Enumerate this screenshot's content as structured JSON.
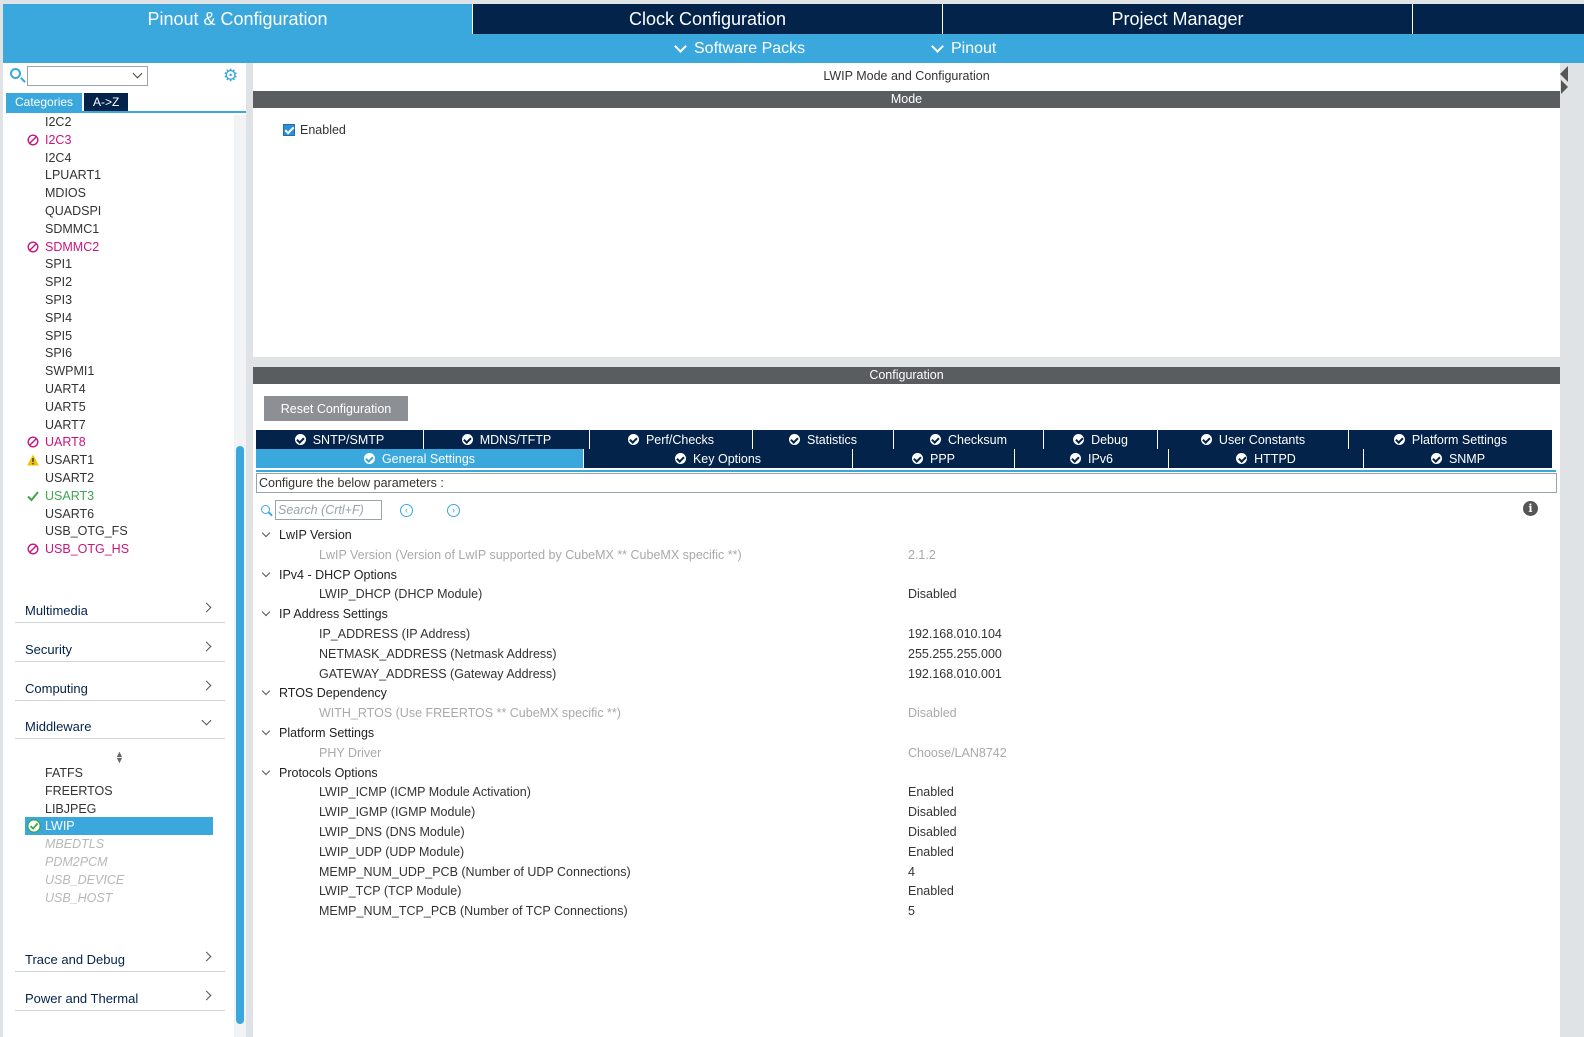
{
  "top_tabs": [
    {
      "label": "Pinout & Configuration"
    },
    {
      "label": "Clock Configuration"
    },
    {
      "label": "Project Manager"
    },
    {
      "label": ""
    }
  ],
  "sub_menu": {
    "software_packs": "Software Packs",
    "pinout": "Pinout"
  },
  "sidebar": {
    "categories_tab": "Categories",
    "az_tab": "A->Z",
    "peripherals": [
      {
        "label": "I2C2",
        "status": "none"
      },
      {
        "label": "I2C3",
        "status": "blocked"
      },
      {
        "label": "I2C4",
        "status": "none"
      },
      {
        "label": "LPUART1",
        "status": "none"
      },
      {
        "label": "MDIOS",
        "status": "none"
      },
      {
        "label": "QUADSPI",
        "status": "none"
      },
      {
        "label": "SDMMC1",
        "status": "none"
      },
      {
        "label": "SDMMC2",
        "status": "blocked"
      },
      {
        "label": "SPI1",
        "status": "none"
      },
      {
        "label": "SPI2",
        "status": "none"
      },
      {
        "label": "SPI3",
        "status": "none"
      },
      {
        "label": "SPI4",
        "status": "none"
      },
      {
        "label": "SPI5",
        "status": "none"
      },
      {
        "label": "SPI6",
        "status": "none"
      },
      {
        "label": "SWPMI1",
        "status": "none"
      },
      {
        "label": "UART4",
        "status": "none"
      },
      {
        "label": "UART5",
        "status": "none"
      },
      {
        "label": "UART7",
        "status": "none"
      },
      {
        "label": "UART8",
        "status": "blocked"
      },
      {
        "label": "USART1",
        "status": "warning"
      },
      {
        "label": "USART2",
        "status": "none"
      },
      {
        "label": "USART3",
        "status": "ok"
      },
      {
        "label": "USART6",
        "status": "none"
      },
      {
        "label": "USB_OTG_FS",
        "status": "none"
      },
      {
        "label": "USB_OTG_HS",
        "status": "blocked"
      }
    ],
    "groups": {
      "multimedia": "Multimedia",
      "security": "Security",
      "computing": "Computing",
      "middleware": "Middleware",
      "trace_debug": "Trace and Debug",
      "power_thermal": "Power and Thermal"
    },
    "middleware_items": [
      {
        "label": "FATFS",
        "status": "none"
      },
      {
        "label": "FREERTOS",
        "status": "none"
      },
      {
        "label": "LIBJPEG",
        "status": "none"
      },
      {
        "label": "LWIP",
        "status": "selected"
      },
      {
        "label": "MBEDTLS",
        "status": "disabled"
      },
      {
        "label": "PDM2PCM",
        "status": "disabled"
      },
      {
        "label": "USB_DEVICE",
        "status": "disabled"
      },
      {
        "label": "USB_HOST",
        "status": "disabled"
      }
    ]
  },
  "mode": {
    "title": "LWIP Mode and Configuration",
    "header": "Mode",
    "enabled_label": "Enabled",
    "enabled": true
  },
  "config": {
    "header": "Configuration",
    "reset_button": "Reset Configuration",
    "tabs_row1": [
      "SNTP/SMTP",
      "MDNS/TFTP",
      "Perf/Checks",
      "Statistics",
      "Checksum",
      "Debug",
      "User Constants",
      "Platform Settings"
    ],
    "tabs_row2": [
      "General Settings",
      "Key Options",
      "PPP",
      "IPv6",
      "HTTPD",
      "SNMP"
    ],
    "active_tab": "General Settings",
    "hint": "Configure the below parameters :",
    "search_placeholder": "Search (Crtl+F)",
    "groups": [
      {
        "name": "LwIP Version",
        "params": [
          {
            "name": "LwIP Version (Version of LwIP supported by CubeMX ** CubeMX specific **)",
            "value": "2.1.2",
            "readonly": true
          }
        ]
      },
      {
        "name": "IPv4 - DHCP Options",
        "params": [
          {
            "name": "LWIP_DHCP (DHCP Module)",
            "value": "Disabled",
            "readonly": false
          }
        ]
      },
      {
        "name": "IP Address Settings",
        "params": [
          {
            "name": "IP_ADDRESS (IP Address)",
            "value": "192.168.010.104",
            "readonly": false
          },
          {
            "name": "NETMASK_ADDRESS (Netmask Address)",
            "value": "255.255.255.000",
            "readonly": false
          },
          {
            "name": "GATEWAY_ADDRESS (Gateway Address)",
            "value": "192.168.010.001",
            "readonly": false
          }
        ]
      },
      {
        "name": "RTOS Dependency",
        "params": [
          {
            "name": "WITH_RTOS (Use FREERTOS ** CubeMX specific **)",
            "value": "Disabled",
            "readonly": true
          }
        ]
      },
      {
        "name": "Platform Settings",
        "params": [
          {
            "name": "PHY Driver",
            "value": "Choose/LAN8742",
            "readonly": true
          }
        ]
      },
      {
        "name": "Protocols Options",
        "params": [
          {
            "name": "LWIP_ICMP (ICMP Module Activation)",
            "value": "Enabled",
            "readonly": false
          },
          {
            "name": "LWIP_IGMP (IGMP Module)",
            "value": "Disabled",
            "readonly": false
          },
          {
            "name": "LWIP_DNS (DNS Module)",
            "value": "Disabled",
            "readonly": false
          },
          {
            "name": "LWIP_UDP (UDP Module)",
            "value": "Enabled",
            "readonly": false
          },
          {
            "name": "MEMP_NUM_UDP_PCB (Number of UDP Connections)",
            "value": "4",
            "readonly": false
          },
          {
            "name": "LWIP_TCP (TCP Module)",
            "value": "Enabled",
            "readonly": false
          },
          {
            "name": "MEMP_NUM_TCP_PCB (Number of TCP Connections)",
            "value": "5",
            "readonly": false
          }
        ]
      }
    ]
  },
  "colors": {
    "accent": "#3aa8dc",
    "navy": "#03234b",
    "blocked": "#c8157e",
    "ok": "#3fa650",
    "warning": "#f2c200"
  }
}
